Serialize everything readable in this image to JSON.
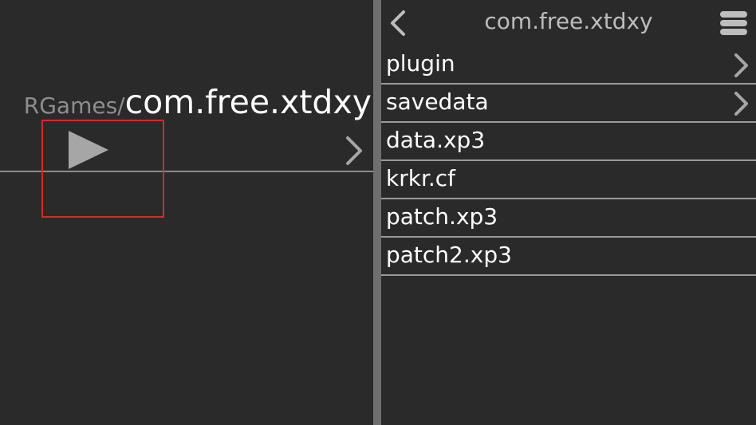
{
  "left_pane": {
    "path_prefix": "RGames/",
    "current_folder": "com.free.xtdxy"
  },
  "right_pane": {
    "title": "com.free.xtdxy",
    "items": [
      {
        "name": "plugin",
        "is_folder": true
      },
      {
        "name": "savedata",
        "is_folder": true
      },
      {
        "name": "data.xp3",
        "is_folder": false
      },
      {
        "name": "krkr.cf",
        "is_folder": false
      },
      {
        "name": "patch.xp3",
        "is_folder": false
      },
      {
        "name": "patch2.xp3",
        "is_folder": false
      }
    ]
  },
  "colors": {
    "background": "#2a2a2a",
    "splitter": "#6f6f6f",
    "highlight": "#d42a2a",
    "icon": "#a6a6a6"
  },
  "icons": {
    "play": "play-icon",
    "chevron_right": "chevron-right-icon",
    "back": "chevron-left-icon",
    "menu": "menu-icon"
  }
}
